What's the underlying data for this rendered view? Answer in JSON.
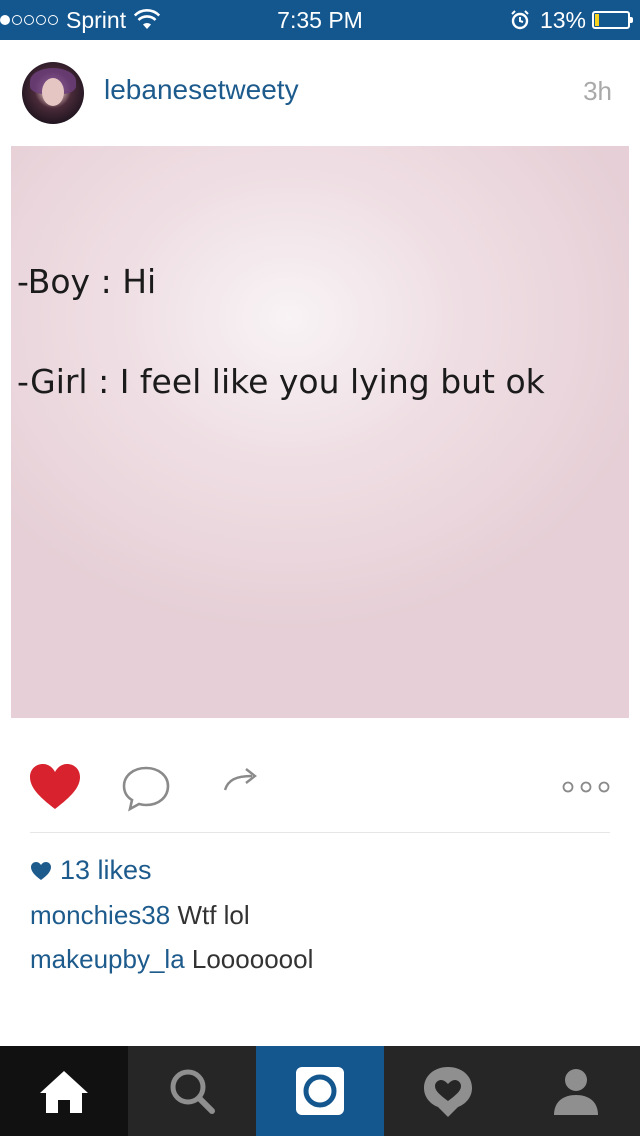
{
  "status_bar": {
    "carrier": "Sprint",
    "time": "7:35 PM",
    "battery": "13%",
    "battery_level": 0.13,
    "signal_bars": 1,
    "icons": [
      "signal-dots-icon",
      "wifi-icon",
      "alarm-icon",
      "battery-icon"
    ]
  },
  "post": {
    "username": "lebanesetweety",
    "time_ago": "3h",
    "image_text": {
      "line1": "-Boy : Hi",
      "line2": "-Girl : I feel like you lying but ok"
    },
    "liked": true,
    "likes_label": "13 likes",
    "comments": [
      {
        "user": "monchies38",
        "text": "Wtf lol"
      },
      {
        "user": "makeupby_la",
        "text": "Loooooool"
      }
    ]
  },
  "actions": [
    "heart-icon",
    "comment-icon",
    "share-icon",
    "more-icon"
  ],
  "tab_bar": {
    "tabs": [
      "home",
      "search",
      "camera",
      "activity",
      "profile"
    ],
    "active": "home"
  },
  "colors": {
    "brand": "#14578f",
    "username": "#1d5b8d",
    "like": "#d8232e",
    "tabbar": "#262626"
  }
}
